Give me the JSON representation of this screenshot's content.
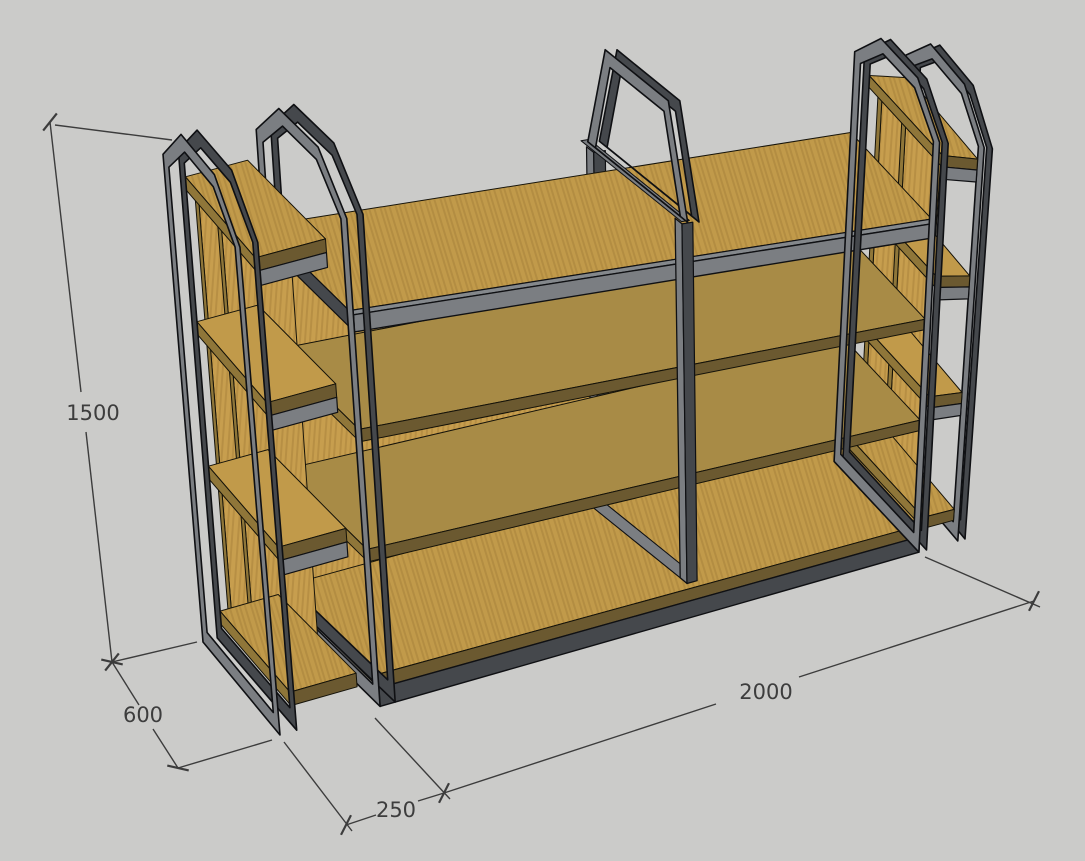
{
  "viewport": {
    "background": "#cbcbc9",
    "kind": "3d-model-view"
  },
  "model": {
    "name": "metal-frame-shelving-unit",
    "colors": {
      "wood_face": "#c79e4e",
      "wood_top": "#c19a4a",
      "wood_top_shaded": "#a88b46",
      "wood_edge": "#6b5930",
      "wood_side": "#8f7639",
      "metal_face": "#7b7e82",
      "metal_light": "#84888c",
      "metal_side": "#45484c",
      "metal_dark": "#33363a",
      "outline": "#141209",
      "metal_outline": "#0f1013"
    }
  },
  "dimensions": {
    "height": "1500",
    "depth": "600",
    "end_bay": "250",
    "main_span": "2000",
    "line_color": "#3c3c3c"
  }
}
